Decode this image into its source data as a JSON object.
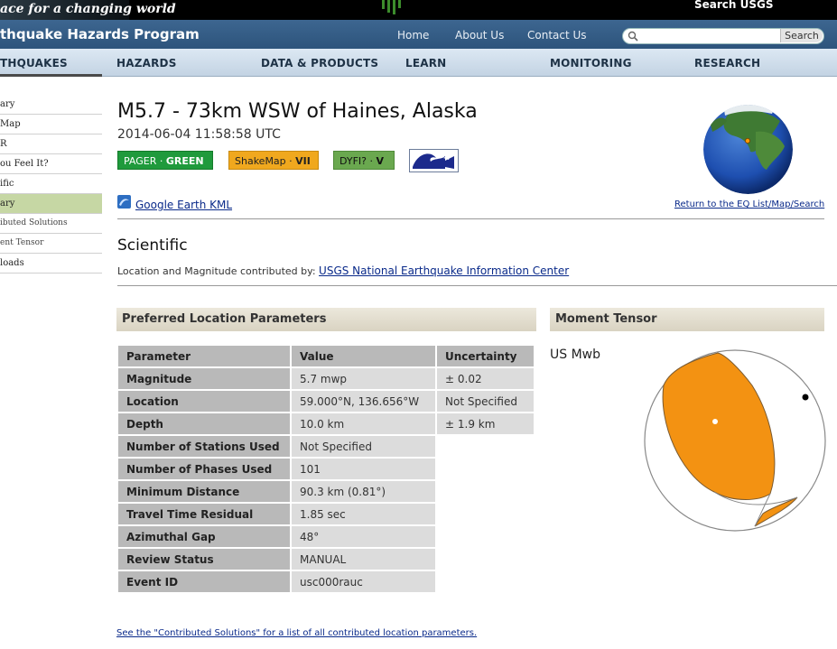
{
  "header": {
    "tagline": "ace for a changing world",
    "search_usgs": "Search USGS",
    "program": "thquake Hazards Program",
    "links": [
      "Home",
      "About Us",
      "Contact Us"
    ],
    "search_button": "Search",
    "search_placeholder": ""
  },
  "nav": [
    "THQUAKES",
    "HAZARDS",
    "DATA & PRODUCTS",
    "LEARN",
    "MONITORING",
    "RESEARCH"
  ],
  "sidebar": [
    {
      "label": "ary",
      "active": false
    },
    {
      "label": "Map",
      "active": false
    },
    {
      "label": "R",
      "active": false
    },
    {
      "label": "ou Feel It?",
      "active": false
    },
    {
      "label": "ific",
      "active": false
    },
    {
      "label": "ary",
      "active": true
    },
    {
      "label": "ibuted Solutions",
      "active": false
    },
    {
      "label": "ent Tensor",
      "active": false
    },
    {
      "label": "loads",
      "active": false
    }
  ],
  "event": {
    "title": "M5.7 - 73km WSW of Haines, Alaska",
    "datetime": "2014-06-04 11:58:58 UTC",
    "badges": {
      "pager_label": "PAGER · ",
      "pager_value": "GREEN",
      "shakemap_label": "ShakeMap · ",
      "shakemap_value": "VII",
      "dyfi_label": "DYFI? · ",
      "dyfi_value": "V"
    },
    "return_link": "Return to the EQ List/Map/Search",
    "kml_link": "Google Earth KML"
  },
  "scientific": {
    "heading": "Scientific",
    "contrib_text": "Location and Magnitude contributed by: ",
    "contrib_link": "USGS National Earthquake Information Center"
  },
  "location_panel": {
    "heading": "Preferred Location Parameters",
    "columns": [
      "Parameter",
      "Value",
      "Uncertainty"
    ],
    "rows": [
      {
        "param": "Magnitude",
        "value": "5.7 mwp",
        "unc": "± 0.02"
      },
      {
        "param": "Location",
        "value": "59.000°N, 136.656°W",
        "unc": "Not Specified"
      },
      {
        "param": "Depth",
        "value": "10.0 km",
        "unc": "± 1.9 km"
      },
      {
        "param": "Number of Stations Used",
        "value": "Not Specified"
      },
      {
        "param": "Number of Phases Used",
        "value": "101"
      },
      {
        "param": "Minimum Distance",
        "value": "90.3 km (0.81°)"
      },
      {
        "param": "Travel Time Residual",
        "value": "1.85 sec"
      },
      {
        "param": "Azimuthal Gap",
        "value": "48°"
      },
      {
        "param": "Review Status",
        "value": "MANUAL"
      },
      {
        "param": "Event ID",
        "value": "usc000rauc"
      }
    ],
    "footer_link": "See the \"Contributed Solutions\" for a list of all contributed location parameters."
  },
  "moment_tensor": {
    "heading": "Moment Tensor",
    "source": "US Mwb"
  },
  "colors": {
    "pager": "#1f9a3c",
    "shakemap": "#f0a81e",
    "dyfi": "#6aa84f",
    "beachball": "#f39212",
    "link": "#0a2a8a"
  }
}
